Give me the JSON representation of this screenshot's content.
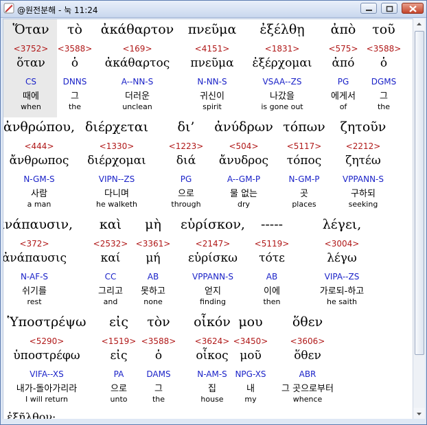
{
  "window": {
    "title": "@원전분해 - 눅 11:24"
  },
  "rows": [
    {
      "words": [
        {
          "greek": "Ὅταν",
          "strong": "<3752>",
          "lemma": "ὅταν",
          "parse": "CS",
          "korean": "때에",
          "english": "when"
        },
        {
          "greek": "τὸ",
          "strong": "<3588>",
          "lemma": "ὁ",
          "parse": "DNNS",
          "korean": "그",
          "english": "the"
        },
        {
          "greek": "ἀκάθαρτον",
          "strong": "<169>",
          "lemma": "ἀκάθαρτος",
          "parse": "A--NN-S",
          "korean": "더러운",
          "english": "unclean"
        },
        {
          "greek": "πνεῦμα",
          "strong": "<4151>",
          "lemma": "πνεῦμα",
          "parse": "N-NN-S",
          "korean": "귀신이",
          "english": "spirit"
        },
        {
          "greek": "ἐξέλθῃ",
          "strong": "<1831>",
          "lemma": "ἐξέρχομαι",
          "parse": "VSAA--ZS",
          "korean": "나갔을",
          "english": "is gone out"
        },
        {
          "greek": "ἀπὸ",
          "strong": "<575>",
          "lemma": "ἀπό",
          "parse": "PG",
          "korean": "에게서",
          "english": "of"
        },
        {
          "greek": "τοῦ",
          "strong": "<3588>",
          "lemma": "ὁ",
          "parse": "DGMS",
          "korean": "그",
          "english": "the"
        }
      ]
    },
    {
      "words": [
        {
          "greek": "ἀνθρώπου,",
          "strong": "<444>",
          "lemma": "ἄνθρωπος",
          "parse": "N-GM-S",
          "korean": "사람",
          "english": "a man"
        },
        {
          "greek": "διέρχεται",
          "strong": "<1330>",
          "lemma": "διέρχομαι",
          "parse": "VIPN--ZS",
          "korean": "다니며",
          "english": "he walketh"
        },
        {
          "greek": "δι’",
          "strong": "<1223>",
          "lemma": "διά",
          "parse": "PG",
          "korean": "으로",
          "english": "through"
        },
        {
          "greek": "ἀνύδρων",
          "strong": "<504>",
          "lemma": "ἄνυδρος",
          "parse": "A--GM-P",
          "korean": "물 없는",
          "english": "dry"
        },
        {
          "greek": "τόπων",
          "strong": "<5117>",
          "lemma": "τόπος",
          "parse": "N-GM-P",
          "korean": "곳",
          "english": "places"
        },
        {
          "greek": "ζητοῦν",
          "strong": "<2212>",
          "lemma": "ζητέω",
          "parse": "VPPANN-S",
          "korean": "구하되",
          "english": "seeking"
        }
      ]
    },
    {
      "words": [
        {
          "greek": "ἀνάπαυσιν,",
          "strong": "<372>",
          "lemma": "ἀνάπαυσις",
          "parse": "N-AF-S",
          "korean": "쉬기를",
          "english": "rest"
        },
        {
          "greek": "καὶ",
          "strong": "<2532>",
          "lemma": "καί",
          "parse": "CC",
          "korean": "그리고",
          "english": "and"
        },
        {
          "greek": "μὴ",
          "strong": "<3361>",
          "lemma": "μή",
          "parse": "AB",
          "korean": "못하고",
          "english": "none"
        },
        {
          "greek": "εὑρίσκον,",
          "strong": "<2147>",
          "lemma": "εὑρίσκω",
          "parse": "VPPANN-S",
          "korean": "얻지",
          "english": "finding"
        },
        {
          "greek": "-----",
          "strong": "<5119>",
          "lemma": "τότε",
          "parse": "AB",
          "korean": "이에",
          "english": "then"
        },
        {
          "greek": "λέγει,",
          "strong": "<3004>",
          "lemma": "λέγω",
          "parse": "VIPA--ZS",
          "korean": "가로되-하고",
          "english": "he saith"
        }
      ]
    },
    {
      "words": [
        {
          "greek": "Ὑποστρέψω",
          "strong": "<5290>",
          "lemma": "ὑποστρέφω",
          "parse": "VIFA--XS",
          "korean": "내가-돌아가리라",
          "english": "I will return"
        },
        {
          "greek": "εἰς",
          "strong": "<1519>",
          "lemma": "εἰς",
          "parse": "PA",
          "korean": "으로",
          "english": "unto"
        },
        {
          "greek": "τὸν",
          "strong": "<3588>",
          "lemma": "ὁ",
          "parse": "DAMS",
          "korean": "그",
          "english": "the"
        },
        {
          "greek": "οἶκόν",
          "strong": "<3624>",
          "lemma": "οἶκος",
          "parse": "N-AM-S",
          "korean": "집",
          "english": "house"
        },
        {
          "greek": "μου",
          "strong": "<3450>",
          "lemma": "μοῦ",
          "parse": "NPG-XS",
          "korean": "내",
          "english": "my"
        },
        {
          "greek": "ὅθεν",
          "strong": "<3606>",
          "lemma": "ὅθεν",
          "parse": "ABR",
          "korean": "그 곳으로부터",
          "english": "whence"
        }
      ]
    }
  ],
  "partial_next_line": "ἐξῆλθον·"
}
